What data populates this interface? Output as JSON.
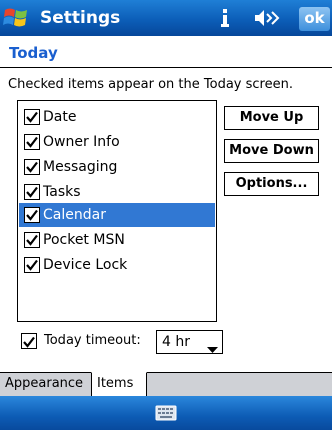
{
  "titlebar": {
    "title": "Settings",
    "ok_label": "ok",
    "icons": [
      "windows-start-icon",
      "connectivity-icon",
      "volume-icon"
    ]
  },
  "page": {
    "title": "Today",
    "instruction": "Checked items appear on the Today screen."
  },
  "items": [
    {
      "label": "Date",
      "checked": true,
      "selected": false
    },
    {
      "label": "Owner Info",
      "checked": true,
      "selected": false
    },
    {
      "label": "Messaging",
      "checked": true,
      "selected": false
    },
    {
      "label": "Tasks",
      "checked": true,
      "selected": false
    },
    {
      "label": "Calendar",
      "checked": true,
      "selected": true
    },
    {
      "label": "Pocket MSN",
      "checked": true,
      "selected": false
    },
    {
      "label": "Device Lock",
      "checked": true,
      "selected": false
    }
  ],
  "buttons": {
    "move_up": "Move Up",
    "move_down": "Move Down",
    "options": "Options..."
  },
  "timeout": {
    "label": "Today timeout:",
    "checked": true,
    "value": "4 hr"
  },
  "tabs": [
    {
      "label": "Appearance",
      "active": false
    },
    {
      "label": "Items",
      "active": true
    }
  ],
  "menubar": {
    "icons": [
      "keyboard-icon"
    ]
  },
  "colors": {
    "title_bar": "#0c5eb8",
    "accent": "#1a5fcf",
    "selection": "#3178d3"
  }
}
